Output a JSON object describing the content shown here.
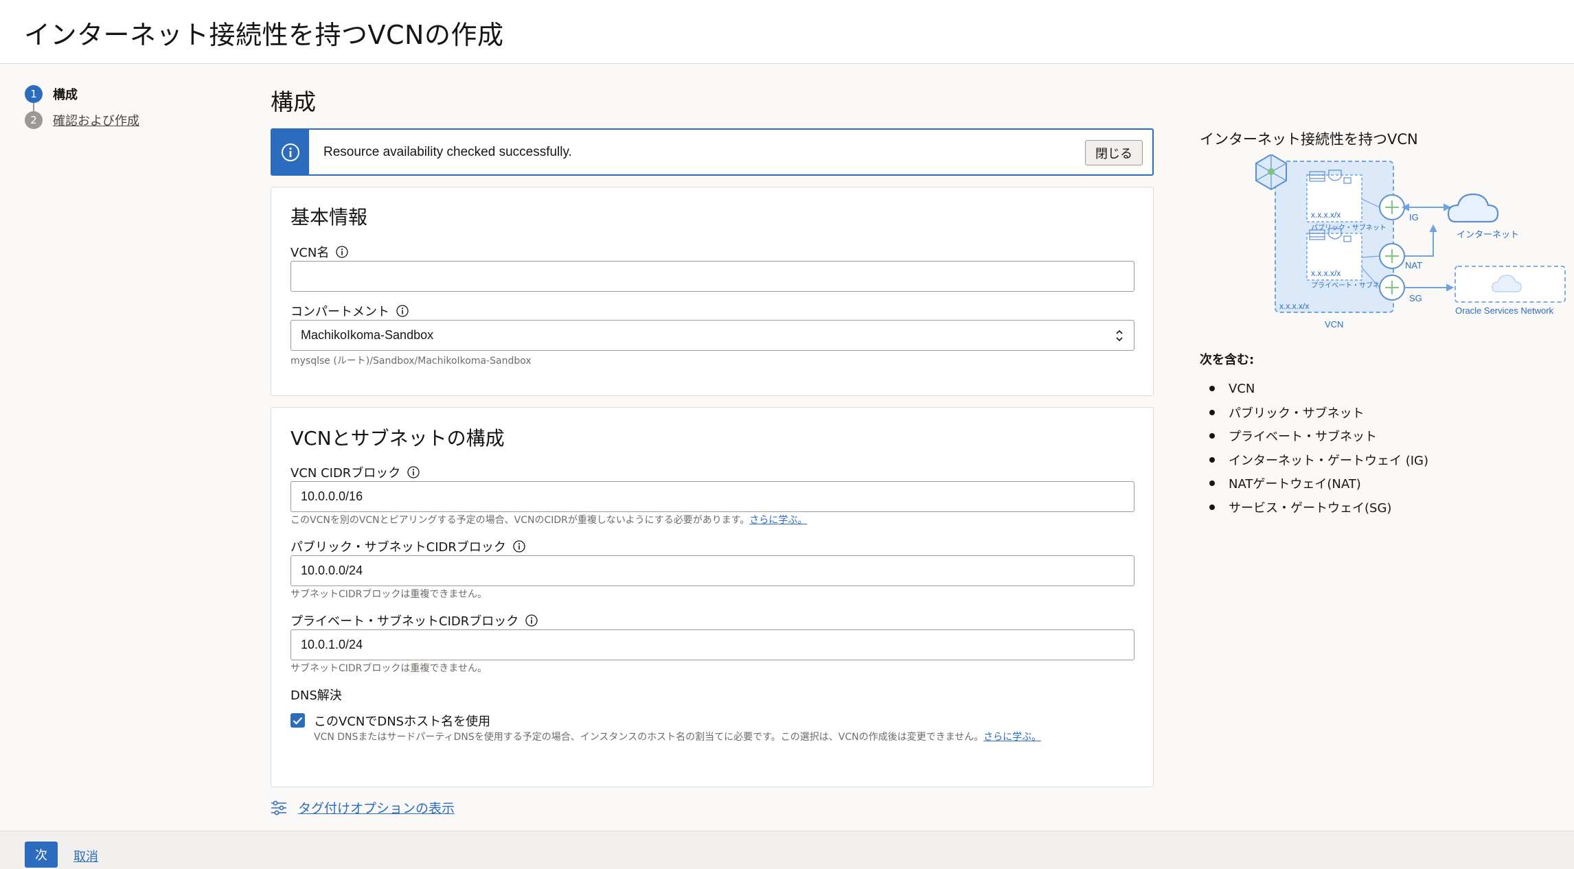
{
  "header": {
    "title": "インターネット接続性を持つVCNの作成"
  },
  "steps": [
    {
      "num": "1",
      "label": "構成"
    },
    {
      "num": "2",
      "label": "確認および作成"
    }
  ],
  "main": {
    "title": "構成"
  },
  "banner": {
    "message": "Resource availability checked successfully.",
    "close_label": "閉じる"
  },
  "basic": {
    "title": "基本情報",
    "vcn_name_label": "VCN名",
    "vcn_name_value": "",
    "compartment_label": "コンパートメント",
    "compartment_value": "MachikoIkoma-Sandbox",
    "compartment_path": "mysqlse (ルート)/Sandbox/MachikoIkoma-Sandbox"
  },
  "vcn": {
    "title": "VCNとサブネットの構成",
    "cidr_label": "VCN CIDRブロック",
    "cidr_value": "10.0.0.0/16",
    "cidr_hint": "このVCNを別のVCNとピアリングする予定の場合、VCNのCIDRが重複しないようにする必要があります。",
    "learn_more": "さらに学ぶ。",
    "public_label": "パブリック・サブネットCIDRブロック",
    "public_value": "10.0.0.0/24",
    "public_hint": "サブネットCIDRブロックは重複できません。",
    "private_label": "プライベート・サブネットCIDRブロック",
    "private_value": "10.0.1.0/24",
    "private_hint": "サブネットCIDRブロックは重複できません。",
    "dns_label": "DNS解決",
    "dns_check_label": "このVCNでDNSホスト名を使用",
    "dns_hint": "VCN DNSまたはサードパーティDNSを使用する予定の場合、インスタンスのホスト名の割当てに必要です。この選択は、VCNの作成後は変更できません。",
    "dns_learn_more": "さらに学ぶ。",
    "dns_checked": true
  },
  "tags_link": "タグ付けオプションの表示",
  "right_panel": {
    "title": "インターネット接続性を持つVCN",
    "diagram": {
      "subnet_cidr_1": "x.x.x.x/x",
      "public_subnet": "パブリック・サブネット",
      "subnet_cidr_2": "x.x.x.x/x",
      "private_subnet": "プライベート・サブネット",
      "vcn_cidr": "x.x.x.x/x",
      "vcn_label": "VCN",
      "ig_label": "IG",
      "nat_label": "NAT",
      "sg_label": "SG",
      "internet_label": "インターネット",
      "osn_label": "Oracle Services Network"
    },
    "includes_label": "次を含む:",
    "includes": [
      "VCN",
      "パブリック・サブネット",
      "プライベート・サブネット",
      "インターネット・ゲートウェイ (IG)",
      "NATゲートウェイ(NAT)",
      "サービス・ゲートウェイ(SG)"
    ]
  },
  "footer": {
    "next_label": "次",
    "cancel_label": "取消"
  },
  "colors": {
    "accent": "#2b6cbf",
    "diagram_blue": "#6fa3e0",
    "diagram_green": "#7cc47f"
  }
}
